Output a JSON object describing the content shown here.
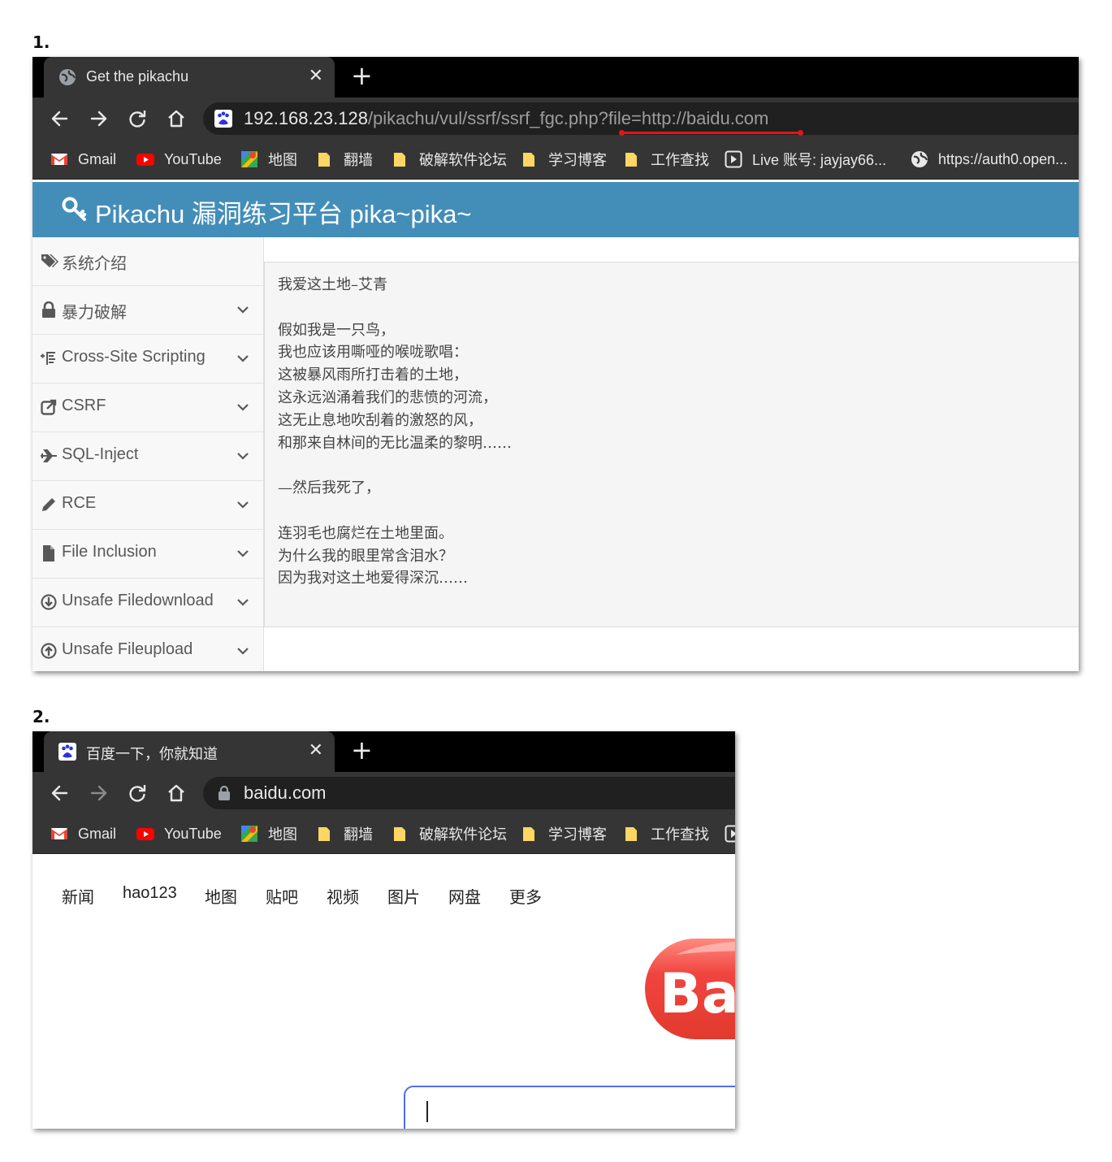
{
  "step1": {
    "label": "1.",
    "tab": {
      "title": "Get the pikachu",
      "close": "✕",
      "new_tab": "+"
    },
    "address": {
      "host": "192.168.23.128",
      "path": "/pikachu/vul/ssrf/ssrf_fgc.php?",
      "query": "file=http://baidu.com"
    },
    "bookmarks": [
      {
        "label": "Gmail",
        "icon": "gmail-icon"
      },
      {
        "label": "YouTube",
        "icon": "youtube-icon"
      },
      {
        "label": "地图",
        "icon": "maps-icon"
      },
      {
        "label": "翻墙",
        "icon": "folder-icon"
      },
      {
        "label": "破解软件论坛",
        "icon": "folder-icon"
      },
      {
        "label": "学习博客",
        "icon": "folder-icon"
      },
      {
        "label": "工作查找",
        "icon": "folder-icon"
      },
      {
        "label": "Live 账号: jayjay66...",
        "icon": "play-icon"
      },
      {
        "label": "https://auth0.open...",
        "icon": "globe-icon"
      }
    ],
    "header_title": "Pikachu 漏洞练习平台 pika~pika~",
    "sidebar": [
      {
        "label": "系统介绍",
        "icon": "tags-icon",
        "expandable": false
      },
      {
        "label": "暴力破解",
        "icon": "lock-icon",
        "expandable": true
      },
      {
        "label": "Cross-Site Scripting",
        "icon": "list-icon",
        "expandable": true
      },
      {
        "label": "CSRF",
        "icon": "share-icon",
        "expandable": true
      },
      {
        "label": "SQL-Inject",
        "icon": "plane-icon",
        "expandable": true
      },
      {
        "label": "RCE",
        "icon": "pencil-icon",
        "expandable": true
      },
      {
        "label": "File Inclusion",
        "icon": "file-icon",
        "expandable": true
      },
      {
        "label": "Unsafe Filedownload",
        "icon": "download-icon",
        "expandable": true
      },
      {
        "label": "Unsafe Fileupload",
        "icon": "upload-icon",
        "expandable": true
      }
    ],
    "poem": [
      "我爱这土地–艾青",
      "",
      "假如我是一只鸟，",
      "我也应该用嘶哑的喉咙歌唱：",
      "这被暴风雨所打击着的土地，",
      "这永远汹涌着我们的悲愤的河流，",
      "这无止息地吹刮着的激怒的风，",
      "和那来自林间的无比温柔的黎明……",
      "",
      "—然后我死了，",
      "",
      "连羽毛也腐烂在土地里面。",
      "为什么我的眼里常含泪水？",
      "因为我对这土地爱得深沉……"
    ],
    "highlight_color": "#e0161a"
  },
  "step2": {
    "label": "2.",
    "tab": {
      "title": "百度一下，你就知道",
      "close": "✕",
      "new_tab": "+"
    },
    "address": {
      "host": "baidu.com"
    },
    "bookmarks": [
      {
        "label": "Gmail",
        "icon": "gmail-icon"
      },
      {
        "label": "YouTube",
        "icon": "youtube-icon"
      },
      {
        "label": "地图",
        "icon": "maps-icon"
      },
      {
        "label": "翻墙",
        "icon": "folder-icon"
      },
      {
        "label": "破解软件论坛",
        "icon": "folder-icon"
      },
      {
        "label": "学习博客",
        "icon": "folder-icon"
      },
      {
        "label": "工作查找",
        "icon": "folder-icon"
      }
    ],
    "nav_links": [
      "新闻",
      "hao123",
      "地图",
      "贴吧",
      "视频",
      "图片",
      "网盘",
      "更多"
    ],
    "logo_text": "Ba",
    "search_value": ""
  },
  "colors": {
    "pikachu_header": "#438eb9",
    "browser_chrome": "#353535",
    "baidu_blue": "#4e6ef2",
    "baidu_red": "#ea3323"
  }
}
